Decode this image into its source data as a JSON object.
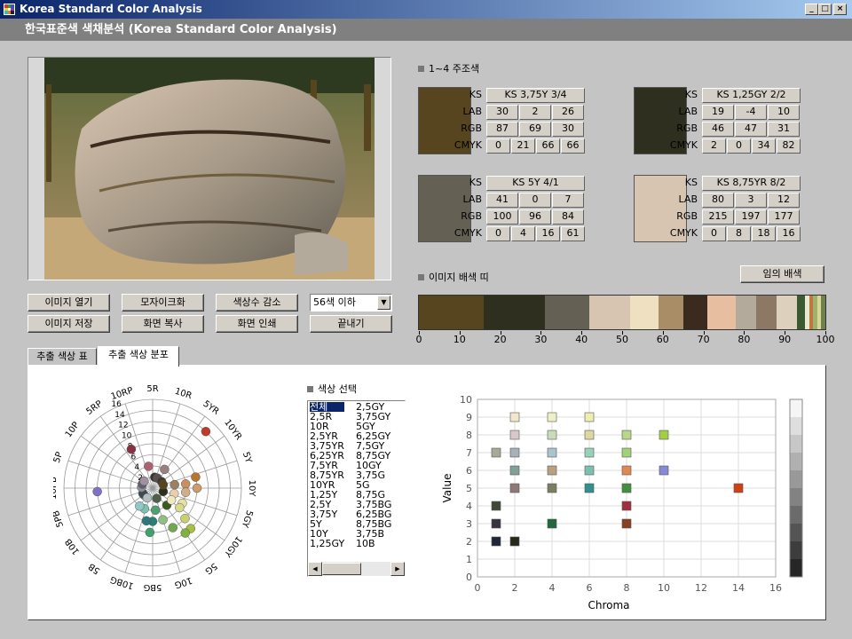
{
  "window": {
    "title": "Korea Standard Color Analysis",
    "buttons": [
      "_",
      "□",
      "×"
    ]
  },
  "header": {
    "title": "한국표준색 색채분석 (Korea Standard Color Analysis)"
  },
  "buttons": {
    "open_image": "이미지 열기",
    "mosaic": "모자이크화",
    "reduce_colors": "색상수 감소",
    "save_image": "이미지 저장",
    "copy_screen": "화면 복사",
    "print_screen": "화면 인쇄",
    "exit": "끝내기",
    "random_palette": "임의 배색"
  },
  "color_count_select": {
    "value": "56색 이하"
  },
  "main_colors": {
    "title": "1~4 주조색",
    "row_labels": {
      "ks": "KS",
      "lab": "LAB",
      "rgb": "RGB",
      "cmyk": "CMYK"
    },
    "colors": [
      {
        "hex": "#574520",
        "ks": "KS 3,75Y 3/4",
        "lab": [
          "30",
          "2",
          "26"
        ],
        "rgb": [
          "87",
          "69",
          "30"
        ],
        "cmyk": [
          "0",
          "21",
          "66",
          "66"
        ]
      },
      {
        "hex": "#2e2f1f",
        "ks": "KS 1,25GY 2/2",
        "lab": [
          "19",
          "-4",
          "10"
        ],
        "rgb": [
          "46",
          "47",
          "31"
        ],
        "cmyk": [
          "2",
          "0",
          "34",
          "82"
        ]
      },
      {
        "hex": "#646054",
        "ks": "KS 5Y 4/1",
        "lab": [
          "41",
          "0",
          "7"
        ],
        "rgb": [
          "100",
          "96",
          "84"
        ],
        "cmyk": [
          "0",
          "4",
          "16",
          "61"
        ]
      },
      {
        "hex": "#d7c5b1",
        "ks": "KS 8,75YR 8/2",
        "lab": [
          "80",
          "3",
          "12"
        ],
        "rgb": [
          "215",
          "197",
          "177"
        ],
        "cmyk": [
          "0",
          "8",
          "18",
          "16"
        ]
      }
    ]
  },
  "palette_strip": {
    "title": "이미지 배색 띠",
    "ticks": [
      "0",
      "10",
      "20",
      "30",
      "40",
      "50",
      "60",
      "70",
      "80",
      "90",
      "100"
    ],
    "segments": [
      {
        "color": "#574520",
        "pct": 16
      },
      {
        "color": "#2e2f1f",
        "pct": 15
      },
      {
        "color": "#646054",
        "pct": 11
      },
      {
        "color": "#d7c5b1",
        "pct": 10
      },
      {
        "color": "#f0e0c2",
        "pct": 7
      },
      {
        "color": "#a88d66",
        "pct": 6
      },
      {
        "color": "#3a2b1e",
        "pct": 6
      },
      {
        "color": "#e8bea0",
        "pct": 7
      },
      {
        "color": "#b4aa9c",
        "pct": 5
      },
      {
        "color": "#8c7864",
        "pct": 5
      },
      {
        "color": "#ddd0bc",
        "pct": 5
      },
      {
        "color": "#3b5a32",
        "pct": 2
      },
      {
        "color": "#e8e8d0",
        "pct": 1
      },
      {
        "color": "#c07838",
        "pct": 1
      },
      {
        "color": "#a0b070",
        "pct": 1
      },
      {
        "color": "#d8d890",
        "pct": 1
      },
      {
        "color": "#708050",
        "pct": 1
      }
    ]
  },
  "tabs": [
    {
      "label": "추출 색상 표",
      "active": false
    },
    {
      "label": "추출 색상 분포",
      "active": true
    }
  ],
  "hue_wheel": {
    "hues": [
      "5R",
      "10R",
      "5YR",
      "10YR",
      "5Y",
      "10Y",
      "5GY",
      "10GY",
      "5G",
      "10G",
      "5BG",
      "10BG",
      "5B",
      "10B",
      "5PB",
      "10PB",
      "5P",
      "10P",
      "5RP",
      "10RP"
    ],
    "rings": [
      "2",
      "4",
      "6",
      "8",
      "10",
      "12",
      "14",
      "16"
    ],
    "points": [
      {
        "hue": 2.4,
        "chroma": 14,
        "color": "#c0392b"
      },
      {
        "hue": 4.2,
        "chroma": 8,
        "color": "#b8752f"
      },
      {
        "hue": 4.6,
        "chroma": 6,
        "color": "#c89060"
      },
      {
        "hue": 5.0,
        "chroma": 8,
        "color": "#d09a6a"
      },
      {
        "hue": 4.5,
        "chroma": 4,
        "color": "#9e8060"
      },
      {
        "hue": 5.4,
        "chroma": 6,
        "color": "#cfae88"
      },
      {
        "hue": 5.8,
        "chroma": 4,
        "color": "#e6d0ae"
      },
      {
        "hue": 6.5,
        "chroma": 6,
        "color": "#e8e0a0"
      },
      {
        "hue": 7.0,
        "chroma": 6,
        "color": "#d8d890"
      },
      {
        "hue": 7.4,
        "chroma": 8,
        "color": "#c8d070"
      },
      {
        "hue": 7.6,
        "chroma": 10,
        "color": "#a8c040"
      },
      {
        "hue": 8.0,
        "chroma": 10,
        "color": "#80b040"
      },
      {
        "hue": 8.5,
        "chroma": 8,
        "color": "#70a850"
      },
      {
        "hue": 9.0,
        "chroma": 6,
        "color": "#90c080"
      },
      {
        "hue": 9.6,
        "chroma": 4,
        "color": "#50a070"
      },
      {
        "hue": 10.0,
        "chroma": 6,
        "color": "#2a8070"
      },
      {
        "hue": 10.6,
        "chroma": 6,
        "color": "#2a7a80"
      },
      {
        "hue": 11.2,
        "chroma": 4,
        "color": "#80c0b0"
      },
      {
        "hue": 12.0,
        "chroma": 4,
        "color": "#90c8c8"
      },
      {
        "hue": 12.8,
        "chroma": 2,
        "color": "#6a8a8a"
      },
      {
        "hue": 13.4,
        "chroma": 2,
        "color": "#404850"
      },
      {
        "hue": 14.8,
        "chroma": 10,
        "color": "#8070c8"
      },
      {
        "hue": 15.2,
        "chroma": 2,
        "color": "#909098"
      },
      {
        "hue": 16.2,
        "chroma": 2,
        "color": "#606070"
      },
      {
        "hue": 17.2,
        "chroma": 2,
        "color": "#a090a0"
      },
      {
        "hue": 18.4,
        "chroma": 8,
        "color": "#8a3040"
      },
      {
        "hue": 19.4,
        "chroma": 4,
        "color": "#b06070"
      },
      {
        "hue": 0.6,
        "chroma": 2,
        "color": "#3a3030"
      },
      {
        "hue": 1.4,
        "chroma": 2,
        "color": "#585050"
      },
      {
        "hue": 3.0,
        "chroma": 2,
        "color": "#403a30"
      },
      {
        "hue": 6.0,
        "chroma": 2,
        "color": "#2e2f1f"
      },
      {
        "hue": 8.8,
        "chroma": 2,
        "color": "#506048"
      },
      {
        "hue": 11.6,
        "chroma": 2,
        "color": "#b0c0c0"
      },
      {
        "hue": 4.0,
        "chroma": 2,
        "color": "#574520"
      },
      {
        "hue": 7.8,
        "chroma": 4,
        "color": "#3a5a20"
      },
      {
        "hue": 10.2,
        "chroma": 8,
        "color": "#40a070"
      },
      {
        "hue": 6.8,
        "chroma": 4,
        "color": "#f0e8c0"
      },
      {
        "hue": 1.8,
        "chroma": 4,
        "color": "#9a8080"
      }
    ]
  },
  "color_select": {
    "title": "색상 선택",
    "col1": [
      "전체",
      "2,5R",
      "10R",
      "2,5YR",
      "3,75YR",
      "6,25YR",
      "7,5YR",
      "8,75YR",
      "10YR",
      "1,25Y",
      "2,5Y",
      "3,75Y",
      "5Y",
      "10Y",
      "1,25GY"
    ],
    "col2": [
      "2,5GY",
      "3,75GY",
      "5GY",
      "6,25GY",
      "7,5GY",
      "8,75GY",
      "10GY",
      "3,75G",
      "5G",
      "8,75G",
      "3,75BG",
      "6,25BG",
      "8,75BG",
      "3,75B",
      "10B"
    ],
    "selected": 0
  },
  "chart_data": {
    "type": "scatter",
    "xlabel": "Chroma",
    "ylabel": "Value",
    "xlim": [
      0,
      16
    ],
    "ylim": [
      0,
      10
    ],
    "xticks": [
      "0",
      "2",
      "4",
      "6",
      "8",
      "10",
      "12",
      "14",
      "16"
    ],
    "yticks": [
      "0",
      "1",
      "2",
      "3",
      "4",
      "5",
      "6",
      "7",
      "8",
      "9",
      "10"
    ],
    "grid": true,
    "points": [
      {
        "x": 2,
        "y": 9,
        "color": "#f2e6cc"
      },
      {
        "x": 4,
        "y": 9,
        "color": "#eef0c8"
      },
      {
        "x": 6,
        "y": 9,
        "color": "#eeeeb0"
      },
      {
        "x": 2,
        "y": 8,
        "color": "#d8c8cc"
      },
      {
        "x": 4,
        "y": 8,
        "color": "#c8dcb8"
      },
      {
        "x": 6,
        "y": 8,
        "color": "#dcd8a0"
      },
      {
        "x": 8,
        "y": 8,
        "color": "#b8d888"
      },
      {
        "x": 10,
        "y": 8,
        "color": "#a0d040"
      },
      {
        "x": 1,
        "y": 7,
        "color": "#aaa898"
      },
      {
        "x": 2,
        "y": 7,
        "color": "#a8b0b8"
      },
      {
        "x": 4,
        "y": 7,
        "color": "#a8c4cc"
      },
      {
        "x": 6,
        "y": 7,
        "color": "#98d0b8"
      },
      {
        "x": 8,
        "y": 7,
        "color": "#a0d078"
      },
      {
        "x": 2,
        "y": 6,
        "color": "#80a098"
      },
      {
        "x": 4,
        "y": 6,
        "color": "#b8a080"
      },
      {
        "x": 6,
        "y": 6,
        "color": "#7cc0b0"
      },
      {
        "x": 8,
        "y": 6,
        "color": "#e08850"
      },
      {
        "x": 10,
        "y": 6,
        "color": "#8888d8"
      },
      {
        "x": 2,
        "y": 5,
        "color": "#907878"
      },
      {
        "x": 4,
        "y": 5,
        "color": "#788060"
      },
      {
        "x": 6,
        "y": 5,
        "color": "#309090"
      },
      {
        "x": 8,
        "y": 5,
        "color": "#409040"
      },
      {
        "x": 14,
        "y": 5,
        "color": "#d04010"
      },
      {
        "x": 1,
        "y": 4,
        "color": "#404838"
      },
      {
        "x": 8,
        "y": 4,
        "color": "#a03040"
      },
      {
        "x": 1,
        "y": 3,
        "color": "#383440"
      },
      {
        "x": 4,
        "y": 3,
        "color": "#206840"
      },
      {
        "x": 8,
        "y": 3,
        "color": "#884020"
      },
      {
        "x": 1,
        "y": 2,
        "color": "#202838"
      },
      {
        "x": 2,
        "y": 2,
        "color": "#282818"
      }
    ]
  }
}
